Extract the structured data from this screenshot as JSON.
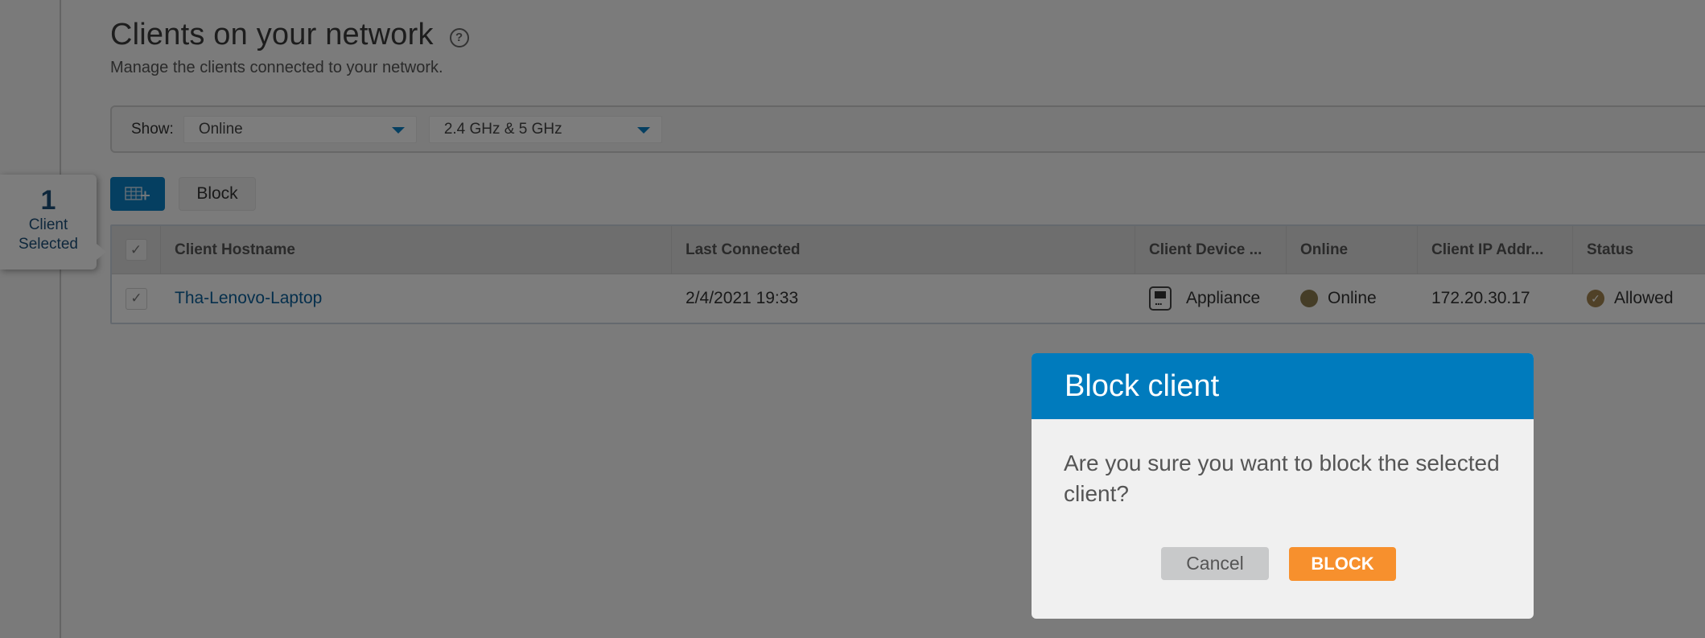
{
  "page": {
    "title": "Clients on your network",
    "help_icon": "question-circle-icon",
    "subtitle": "Manage the clients connected to your network."
  },
  "filters": {
    "show_label": "Show:",
    "status_selected": "Online",
    "band_selected": "2.4 GHz & 5 GHz"
  },
  "toolbar": {
    "columns_icon": "table-add-column-icon",
    "block_label": "Block"
  },
  "selection": {
    "count": "1",
    "label_line1": "Client",
    "label_line2": "Selected"
  },
  "table": {
    "columns": [
      "Client Hostname",
      "Last Connected",
      "Client Device ...",
      "Online",
      "Client IP Addr...",
      "Status"
    ],
    "rows": [
      {
        "selected": true,
        "hostname": "Tha-Lenovo-Laptop",
        "last_connected": "2/4/2021 19:33",
        "device_type": "Appliance",
        "device_icon": "appliance-icon",
        "online": "Online",
        "ip": "172.20.30.17",
        "status": "Allowed",
        "status_icon": "check-circle-icon"
      }
    ]
  },
  "dialog": {
    "title": "Block client",
    "message": "Are you sure you want to block the selected client?",
    "cancel_label": "Cancel",
    "confirm_label": "BLOCK"
  },
  "colors": {
    "dialog_header": "#007bbd",
    "confirm_button": "#f7902d",
    "cancel_button": "#c8c9ca",
    "link": "#0a5e99",
    "accent": "#0a7ec2"
  }
}
